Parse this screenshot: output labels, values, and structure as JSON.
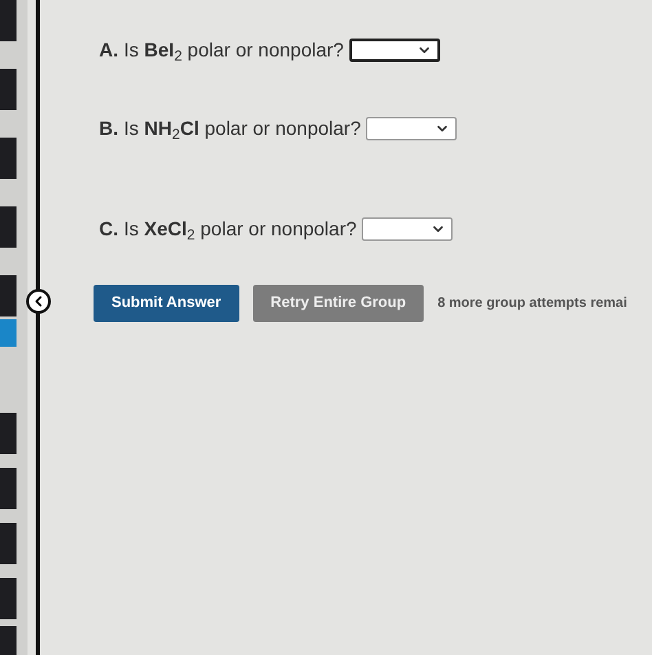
{
  "questions": [
    {
      "label": "A.",
      "text": "Is **BeI**$_{2}$ polar or nonpolar?"
    },
    {
      "label": "B.",
      "text": "Is **NH**$_{2}$**Cl** polar or nonpolar?"
    },
    {
      "label": "C.",
      "text": "Is **XeCl**$_{2}$ polar or nonpolar?"
    }
  ],
  "buttons": [
    {
      "label": "Submit Answer",
      "kind": "primary"
    },
    {
      "label": "Retry Entire Group",
      "kind": "secondary"
    }
  ],
  "attempts_note": "8 more group attempts remai"
}
